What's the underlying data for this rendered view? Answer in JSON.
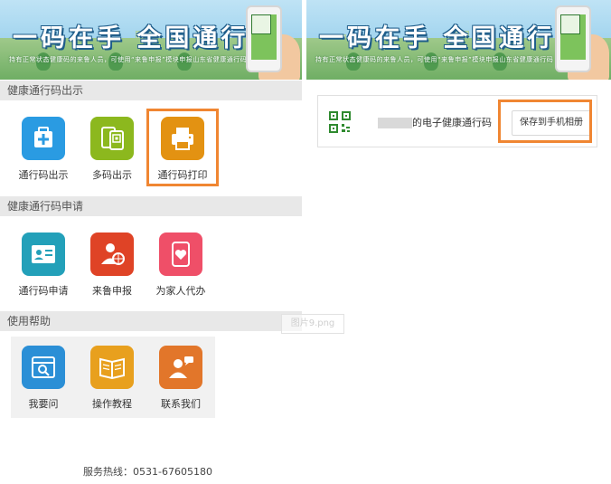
{
  "banner": {
    "slogan": "一码在手  全国通行",
    "subtitle": "持有正常状态健康码的来鲁人员，可使用“来鲁申报”模块申报山东省健康通行码"
  },
  "sections": {
    "show": {
      "title": "健康通行码出示",
      "items": [
        {
          "label": "通行码出示",
          "icon": "medical-box-icon",
          "color": "#2a9be2"
        },
        {
          "label": "多码出示",
          "icon": "multi-code-icon",
          "color": "#8cb81e"
        },
        {
          "label": "通行码打印",
          "icon": "printer-icon",
          "color": "#e39212"
        }
      ]
    },
    "apply": {
      "title": "健康通行码申请",
      "items": [
        {
          "label": "通行码申请",
          "icon": "id-card-icon",
          "color": "#23a0b9"
        },
        {
          "label": "来鲁申报",
          "icon": "person-globe-icon",
          "color": "#df4326"
        },
        {
          "label": "为家人代办",
          "icon": "phone-heart-icon",
          "color": "#ef4f68"
        }
      ]
    },
    "help": {
      "title": "使用帮助",
      "items": [
        {
          "label": "我要问",
          "icon": "calendar-search-icon",
          "color": "#2b8fd6"
        },
        {
          "label": "操作教程",
          "icon": "open-book-icon",
          "color": "#e8a01e"
        },
        {
          "label": "联系我们",
          "icon": "contact-person-icon",
          "color": "#e2762a"
        }
      ]
    }
  },
  "hotline": "服务热线：0531-67605180",
  "watermark": "图片9.png",
  "card": {
    "label": "的电子健康通行码",
    "save_button": "保存到手机相册"
  },
  "colors": {
    "highlight": "#f08632",
    "section_bg": "#e8e8e8"
  }
}
